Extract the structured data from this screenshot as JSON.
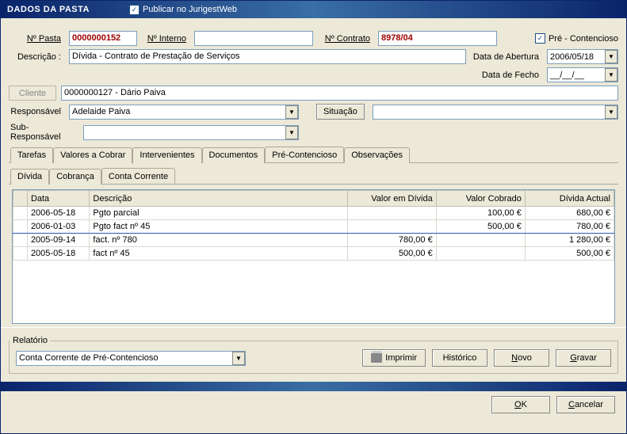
{
  "title": "DADOS DA PASTA",
  "publicar_label": "Publicar no JurigestWeb",
  "publicar_checked": true,
  "labels": {
    "n_pasta": "Nº Pasta",
    "n_interno": "Nº Interno",
    "n_contrato": "Nº Contrato",
    "pre_contencioso": "Pré - Contencioso",
    "descricao": "Descrição :",
    "data_abertura": "Data de Abertura",
    "data_fecho": "Data de Fecho",
    "cliente": "Cliente",
    "responsavel": "Responsável",
    "situacao": "Situação",
    "sub_responsavel": "Sub-Responsável",
    "relatorio": "Relatório"
  },
  "values": {
    "n_pasta": "0000000152",
    "n_interno": "",
    "n_contrato": "8978/04",
    "pre_contencioso_checked": true,
    "descricao": "Dívida - Contrato de Prestação de Serviços",
    "data_abertura": "2006/05/18",
    "data_fecho": "__/__/__",
    "cliente": "0000000127 - Dário Paiva",
    "responsavel": "Adelaide Paiva",
    "situacao": "",
    "sub_responsavel": "",
    "relatorio": "Conta Corrente de Pré-Contencioso"
  },
  "tabs_main": [
    "Tarefas",
    "Valores a Cobrar",
    "Intervenientes",
    "Documentos",
    "Pré-Contencioso",
    "Observações"
  ],
  "tabs_main_active": 4,
  "tabs_sub": [
    "Dívida",
    "Cobrança",
    "Conta Corrente"
  ],
  "tabs_sub_active": 2,
  "table": {
    "headers": [
      "Data",
      "Descrição",
      "Valor em Dívida",
      "Valor Cobrado",
      "Dívida Actual"
    ],
    "rows": [
      {
        "data": "2006-05-18",
        "desc": "Pgto parcial",
        "vd": "",
        "vc": "100,00 €",
        "da": "680,00 €"
      },
      {
        "data": "2006-01-03",
        "desc": "Pgto fact nº 45",
        "vd": "",
        "vc": "500,00 €",
        "da": "780,00 €",
        "hi": true
      },
      {
        "data": "2005-09-14",
        "desc": "fact. nº 780",
        "vd": "780,00 €",
        "vc": "",
        "da": "1 280,00 €"
      },
      {
        "data": "2005-05-18",
        "desc": "fact nº 45",
        "vd": "500,00 €",
        "vc": "",
        "da": "500,00 €"
      }
    ]
  },
  "buttons": {
    "imprimir": "Imprimir",
    "historico": "Histórico",
    "novo": "Novo",
    "gravar": "Gravar",
    "ok": "OK",
    "cancelar": "Cancelar"
  }
}
